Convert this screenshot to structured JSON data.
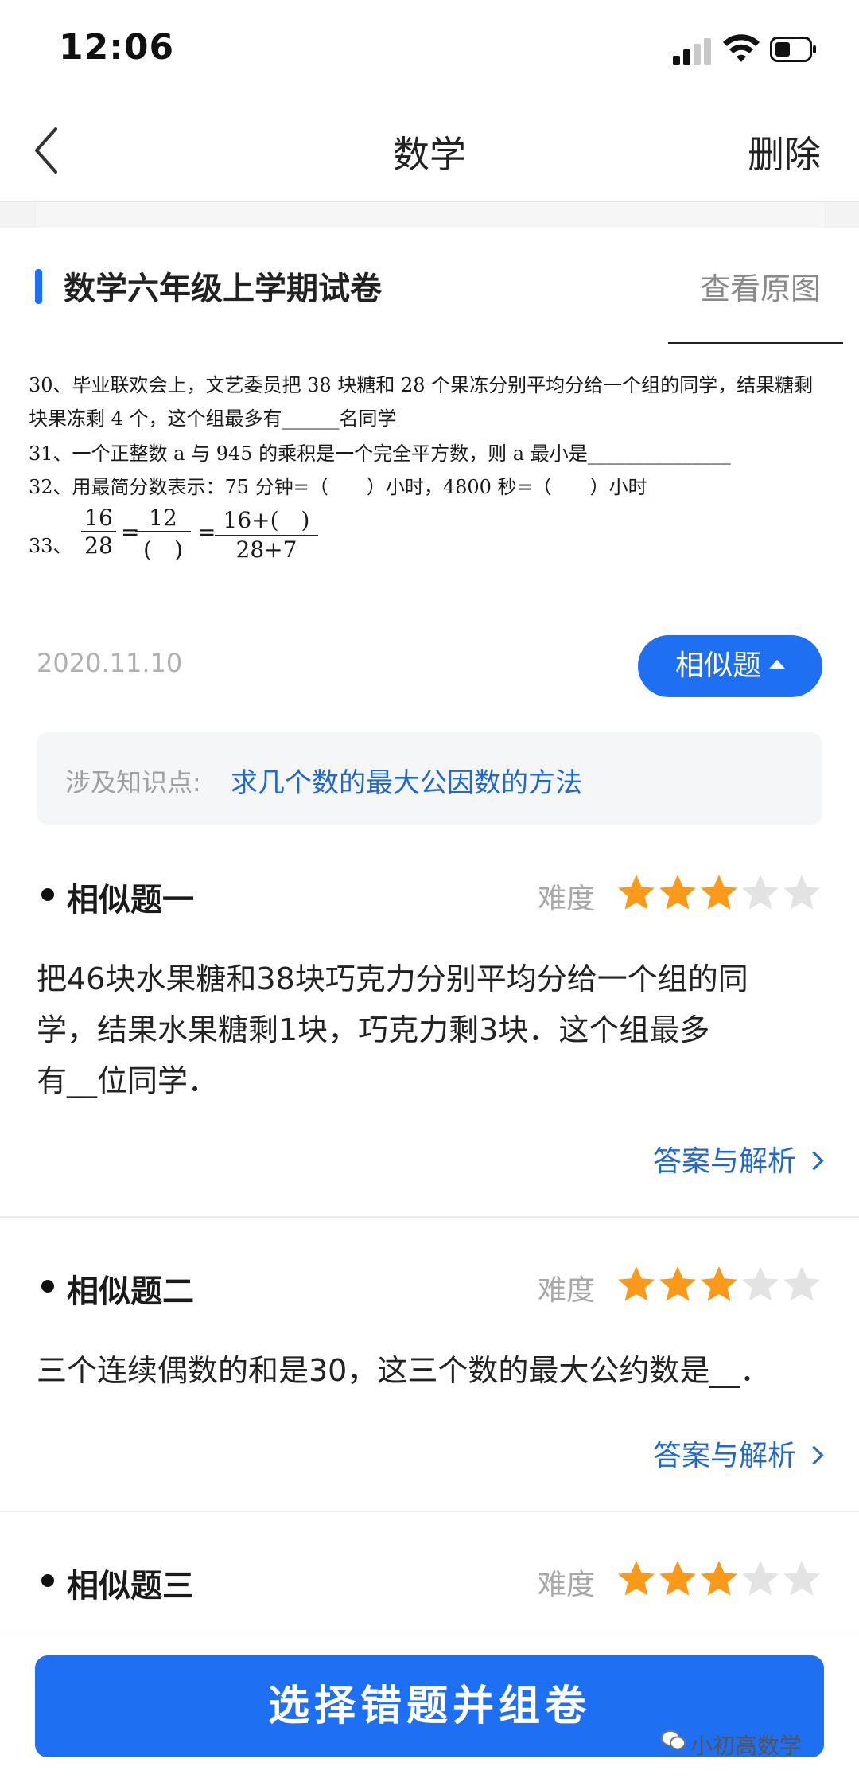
{
  "status_bar": {
    "time": "12:06"
  },
  "nav": {
    "title": "数学",
    "delete_label": "删除"
  },
  "paper": {
    "title": "数学六年级上学期试卷",
    "view_original": "查看原图",
    "date": "2020.11.10",
    "similar_button": "相似题",
    "scan_lines": [
      "30、毕业联欢会上，文艺委员把 38 块糖和 28 个果冻分别平均分给一个组的同学，结果糖剩",
      "块果冻剩 4 个，这个组最多有______名同学",
      "31、一个正整数 a 与 945 的乘积是一个完全平方数，则 a 最小是_______________",
      "32、用最简分数表示：75 分钟=（　　）小时，4800 秒=（　　）小时",
      "33、"
    ],
    "fractions": {
      "f1_num": "16",
      "f1_den": "28",
      "eq": "=",
      "f2_num": "12",
      "f2_den": "(　)",
      "f3_num": "16+(　)",
      "f3_den": "28+7"
    }
  },
  "knowledge": {
    "label": "涉及知识点:",
    "link": "求几个数的最大公因数的方法"
  },
  "difficulty_label": "难度",
  "star_colors": {
    "filled": "#fb9a1a",
    "empty": "#e3e3e3"
  },
  "questions": [
    {
      "title": "相似题一",
      "difficulty": 3,
      "body_lines": [
        "把46块水果糖和38块巧克力分别平均分给一个组的同",
        "学，结果水果糖剩1块，巧克力剩3块．这个组最多",
        "有__位同学．"
      ],
      "answer_link": "答案与解析"
    },
    {
      "title": "相似题二",
      "difficulty": 3,
      "body_lines": [
        "三个连续偶数的和是30，这三个数的最大公约数是__．"
      ],
      "answer_link": "答案与解析"
    },
    {
      "title": "相似题三",
      "difficulty": 3
    }
  ],
  "bottom": {
    "compose_button": "选择错题并组卷",
    "watermark": "小初高数学"
  },
  "accent_color": "#1f6ff2"
}
